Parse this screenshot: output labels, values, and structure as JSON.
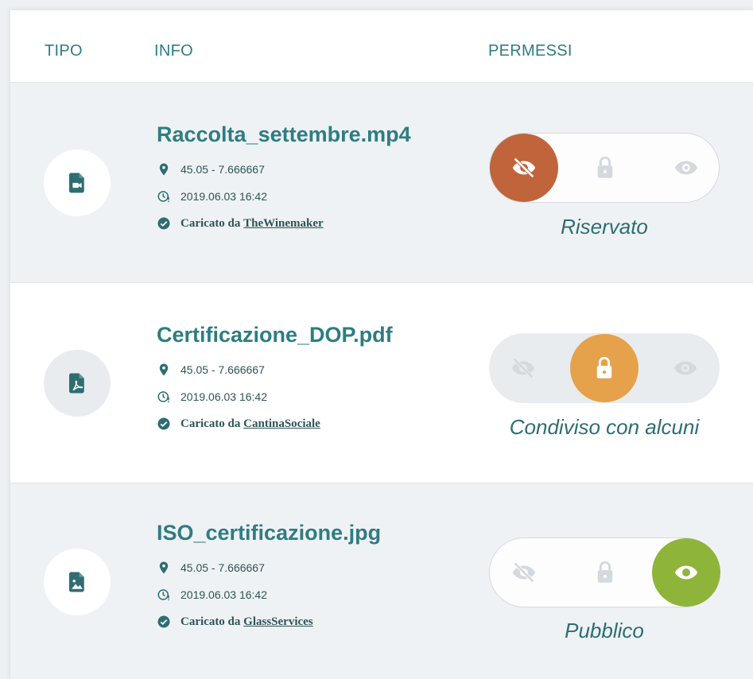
{
  "header": {
    "col_type": "TIPO",
    "col_info": "INFO",
    "col_perms": "PERMESSI"
  },
  "colors": {
    "teal": "#2e7d82",
    "reserved": "#c0643b",
    "shared": "#e5a24b",
    "public": "#8fb43a",
    "inactive_icon": "#d3d9dc"
  },
  "files": [
    {
      "name": "Raccolta_settembre.mp4",
      "type_icon": "video-file-icon",
      "coords": "45.05 - 7.666667",
      "datetime": "2019.06.03 16:42",
      "uploaded_prefix": "Caricato da",
      "uploader": "TheWinemaker",
      "permission": "Riservato",
      "active_option": "hidden"
    },
    {
      "name": "Certificazione_DOP.pdf",
      "type_icon": "pdf-file-icon",
      "coords": "45.05 - 7.666667",
      "datetime": "2019.06.03 16:42",
      "uploaded_prefix": "Caricato da",
      "uploader": "CantinaSociale",
      "permission": "Condiviso con alcuni",
      "active_option": "locked"
    },
    {
      "name": "ISO_certificazione.jpg",
      "type_icon": "image-file-icon",
      "coords": "45.05 - 7.666667",
      "datetime": "2019.06.03 16:42",
      "uploaded_prefix": "Caricato da",
      "uploader": "GlassServices",
      "permission": "Pubblico",
      "active_option": "public"
    }
  ]
}
